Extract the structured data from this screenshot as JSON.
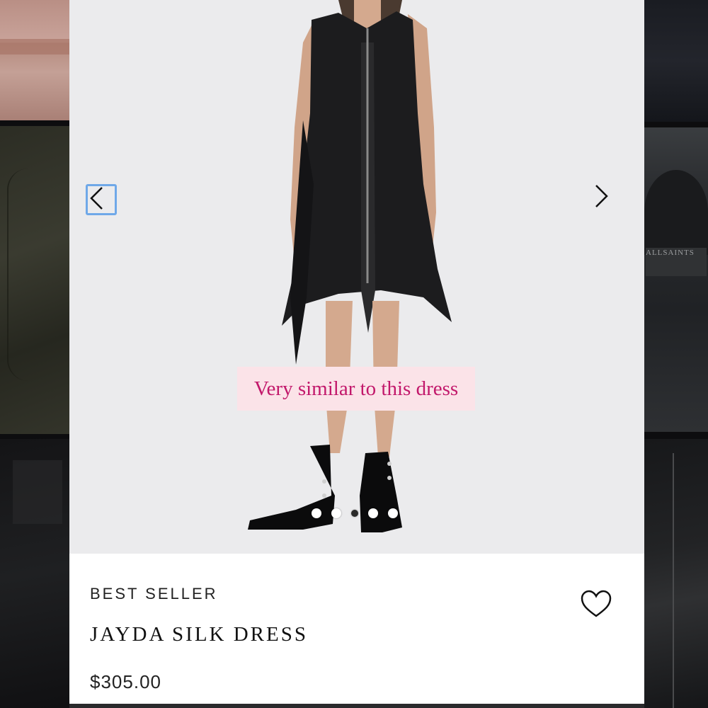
{
  "collage": {
    "right_mid_label": "ALLSAINTS"
  },
  "product": {
    "badge": "BEST SELLER",
    "name": "JAYDA SILK DRESS",
    "price": "$305.00"
  },
  "caption": {
    "text": "Very similar to this dress",
    "color": "#c2186b",
    "background": "#fbe3e8"
  },
  "carousel": {
    "prev_icon": "chevron-left-icon",
    "next_icon": "chevron-right-icon",
    "slide_count": 5,
    "active_index": 2
  },
  "icons": {
    "wishlist": "heart-outline-icon"
  },
  "colors": {
    "focus_outline": "#6fa8e8",
    "hero_background": "#ebebed"
  }
}
